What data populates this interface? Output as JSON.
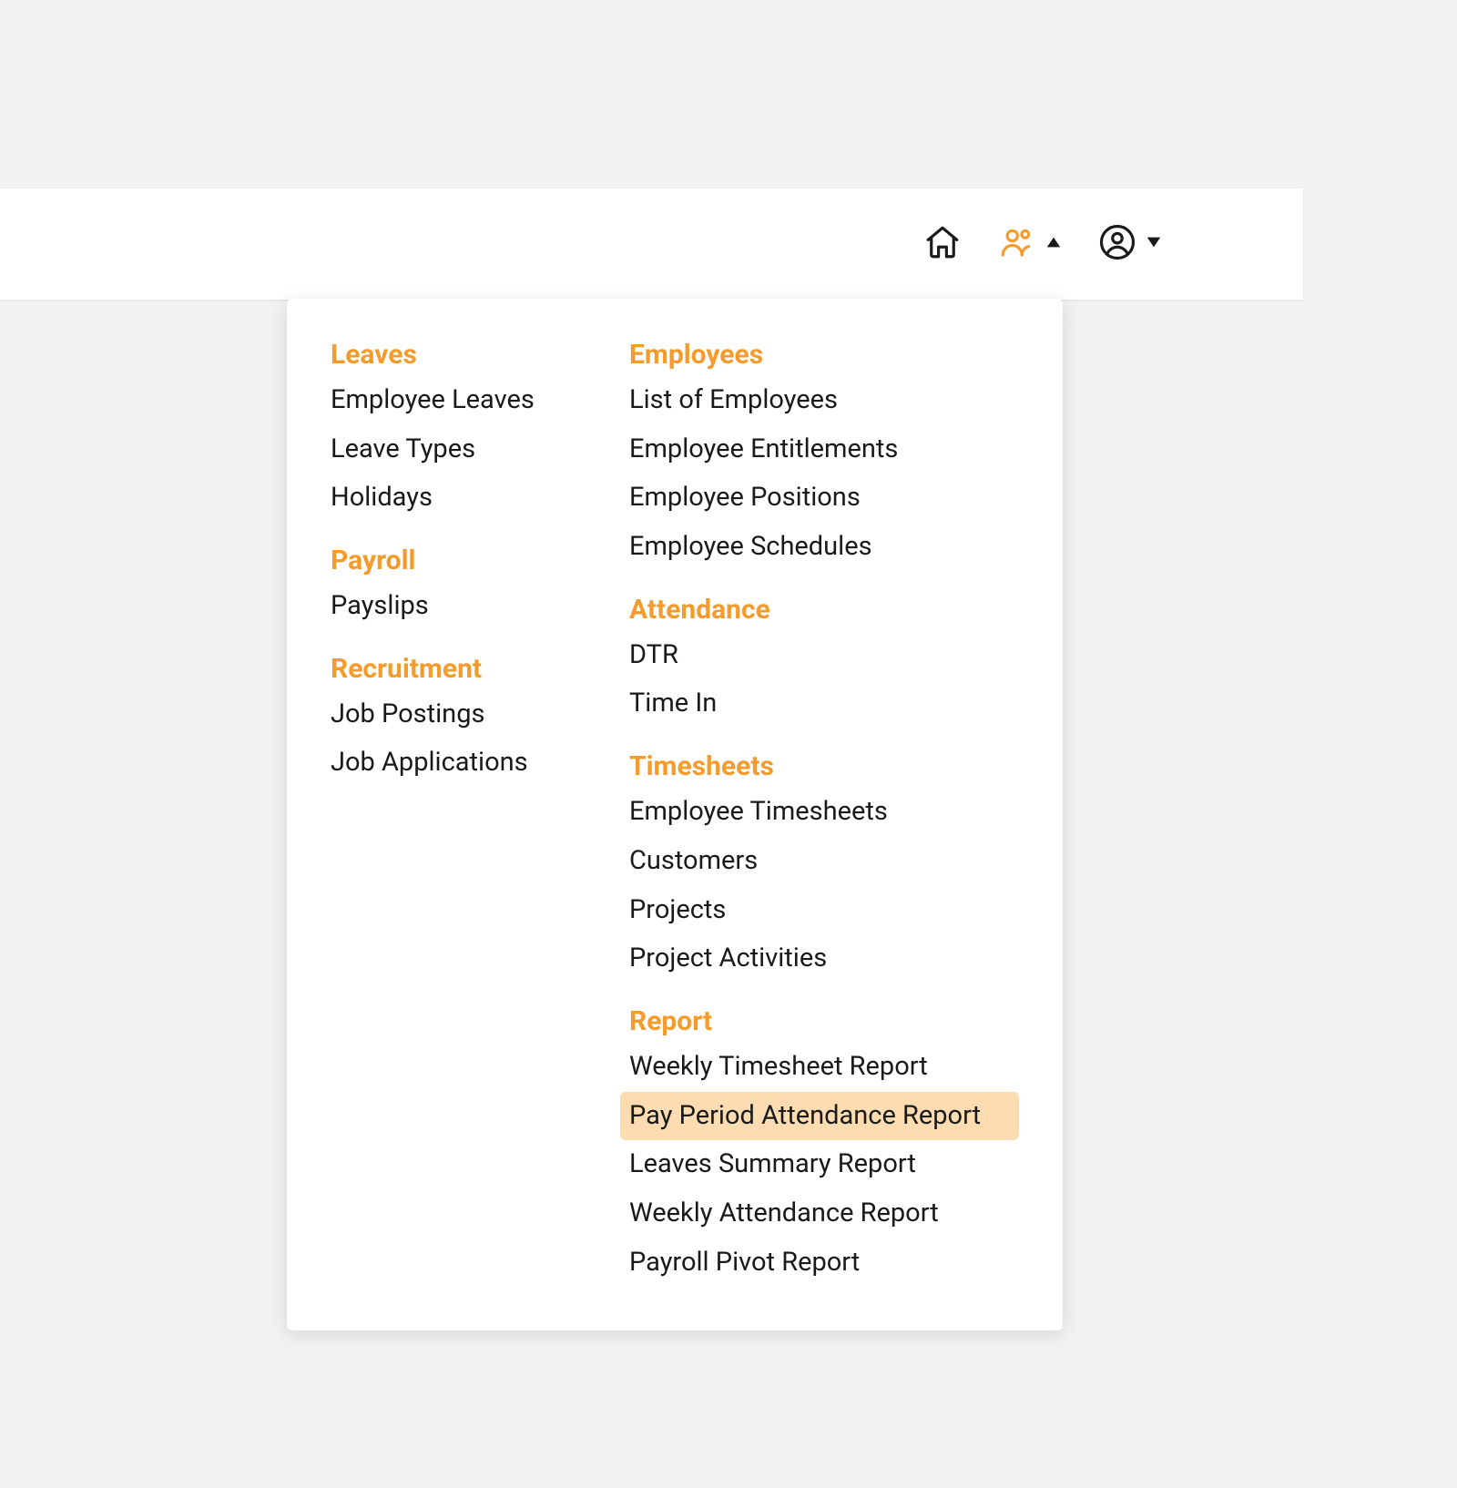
{
  "topbar": {
    "icons": {
      "home": "home-icon",
      "team": "team-icon",
      "user": "user-icon"
    }
  },
  "menu": {
    "left": [
      {
        "header": "Leaves",
        "items": [
          "Employee Leaves",
          "Leave Types",
          "Holidays"
        ]
      },
      {
        "header": "Payroll",
        "items": [
          "Payslips"
        ]
      },
      {
        "header": "Recruitment",
        "items": [
          "Job Postings",
          "Job Applications"
        ]
      }
    ],
    "right": [
      {
        "header": "Employees",
        "items": [
          "List of Employees",
          "Employee Entitlements",
          "Employee Positions",
          "Employee Schedules"
        ]
      },
      {
        "header": "Attendance",
        "items": [
          "DTR",
          "Time In"
        ]
      },
      {
        "header": "Timesheets",
        "items": [
          "Employee Timesheets",
          "Customers",
          "Projects",
          "Project Activities"
        ]
      },
      {
        "header": "Report",
        "items": [
          "Weekly Timesheet Report",
          "Pay Period Attendance Report",
          "Leaves Summary Report",
          "Weekly Attendance Report",
          "Payroll Pivot Report"
        ],
        "highlighted": "Pay Period Attendance Report"
      }
    ]
  }
}
